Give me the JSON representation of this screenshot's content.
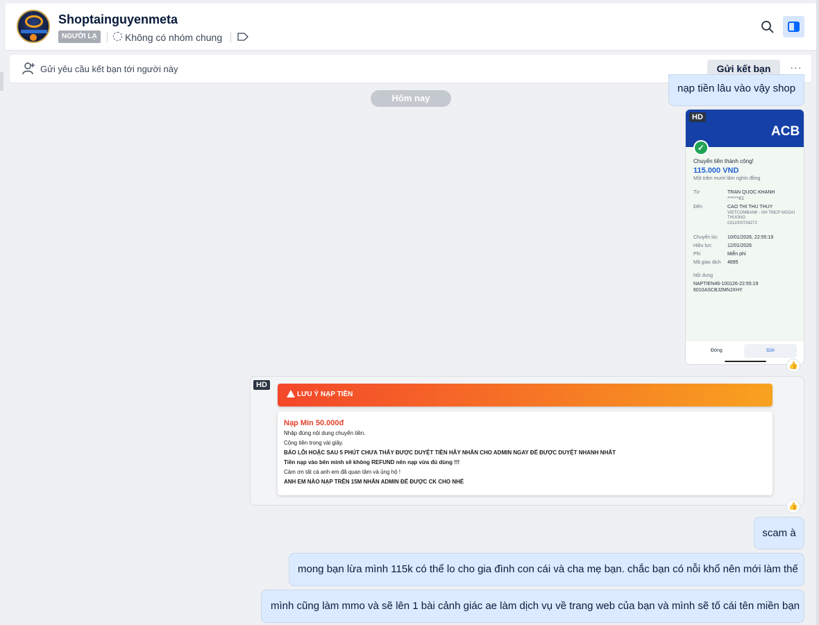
{
  "header": {
    "name": "Shoptainguyenmeta",
    "badge": "NGƯỜI LẠ",
    "group_status": "Không có nhóm chung"
  },
  "friend_bar": {
    "text": "Gửi yêu cầu kết bạn tới người này",
    "button": "Gửi kết bạn",
    "more": "···"
  },
  "date_separator": "Hôm nay",
  "messages": {
    "m1": "nạp tiền lâu vào vậy shop",
    "m2": "scam à",
    "m3": "mong bạn lừa mình 115k có thể lo cho gia đình con cái và cha mẹ bạn. chắc bạn có nỗi khổ nên mới làm thế",
    "m4": "mình cũng làm mmo và sẽ lên 1 bài cảnh giác ae làm dịch vụ về trang web của bạn và mình sẽ tố cái tên miền bạn"
  },
  "hd_label": "HD",
  "receipt": {
    "bank": "ACB",
    "status_title": "Chuyển tiền thành công!",
    "amount": "115.000 VND",
    "amount_words": "Một trăm mười lăm nghìn đồng",
    "from_label": "Từ",
    "from_name": "TRAN QUOC KHANH",
    "from_acct": "******81",
    "to_label": "Đến",
    "to_name": "CAO THI THU THUY",
    "to_bank1": "VIETCOMBANK - NH TMCP NGOAI",
    "to_bank2": "THUONG",
    "to_acct": "0311000734272",
    "transfer_label": "Chuyển lúc",
    "transfer_time": "10/01/2026, 22:55:19",
    "effective_label": "Hiệu lực",
    "effective_date": "12/01/2026",
    "fee_label": "Phí",
    "fee": "Miễn phí",
    "txn_label": "Mã giao dịch",
    "txn": "4895",
    "content_label": "Nội dung",
    "content1": "NAPTIEN46-100126-22:55:19",
    "content2": "6010ASCBJ2MNJXHY",
    "close": "Đóng",
    "share": "Gửi"
  },
  "notice": {
    "title": "LƯU Ý NẠP TIỀN",
    "min": "Nạp Min 50.000đ",
    "l1": "Nhập đúng nội dung chuyển tiền.",
    "l2": "Cộng tiền trong vài giây.",
    "l3": "BÁO LỖI HOẶC SAU 5 PHÚT CHƯA THẤY ĐƯỢC DUYỆT TIỀN HÃY NHẮN CHO ADMIN NGAY ĐỂ ĐƯỢC DUYỆT NHANH NHẤT",
    "l4": "Tiền nạp vào bên mình sẽ không REFUND nên nạp vừa đủ dùng !!!",
    "l5": "Cảm ơn tất cả anh em đã quan tâm và ủng hộ !",
    "l6": "ANH EM NÀO NẠP TRÊN 15M NHẮN ADMIN ĐỂ ĐƯỢC CK CHO NHÉ"
  },
  "icons": {
    "like": "thumbs-up-icon",
    "search": "search-icon",
    "panel": "sidebar-toggle-icon",
    "tag": "tag-icon",
    "add_friend": "add-user-icon",
    "group": "group-dashed-icon"
  },
  "colors": {
    "accent": "#0068ff",
    "message_bg": "#dbeafe",
    "badge_bg": "#a7acb4"
  }
}
